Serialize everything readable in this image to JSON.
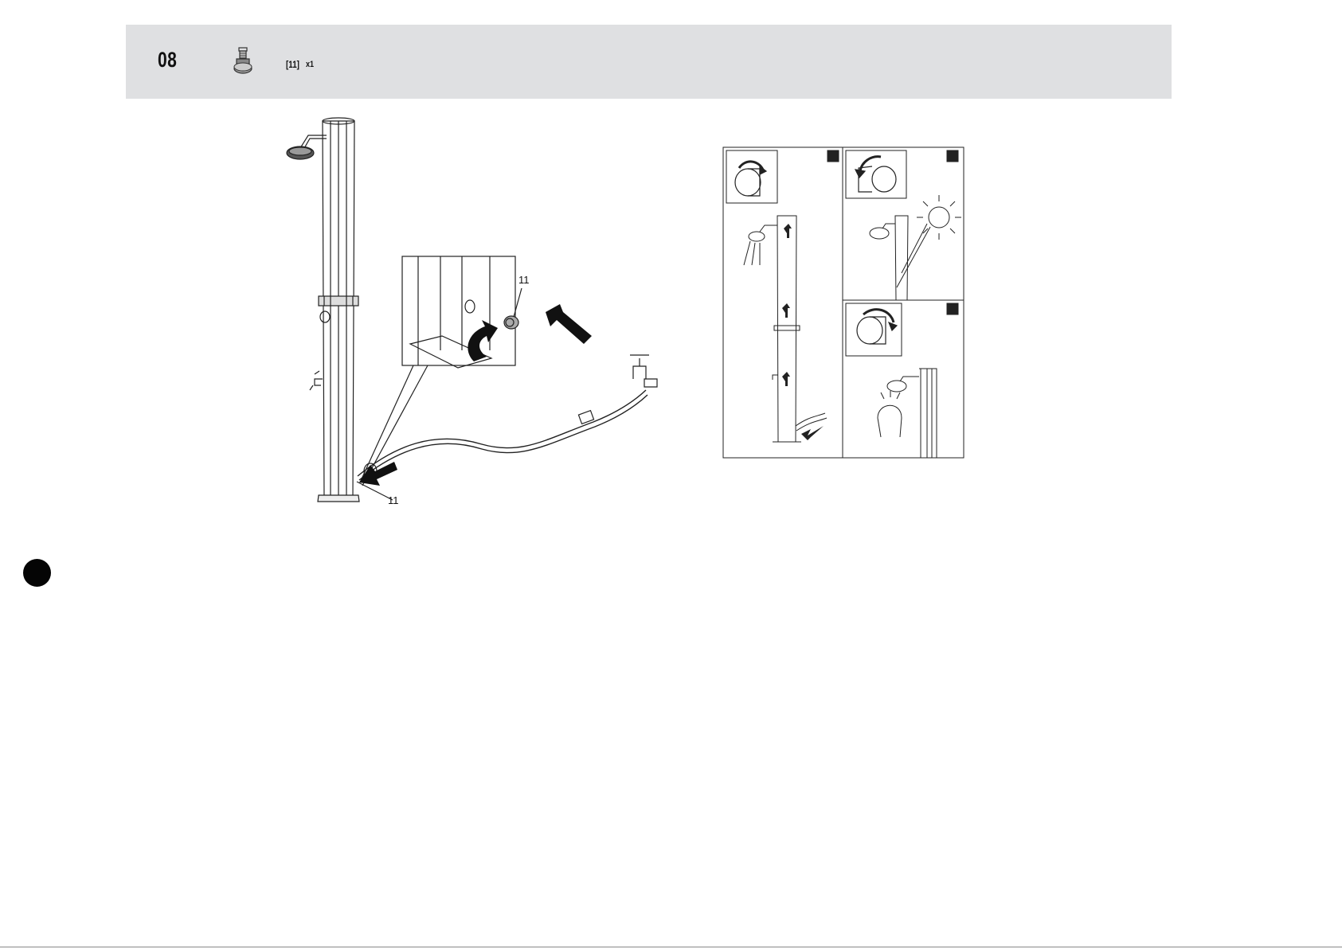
{
  "header": {
    "step_number": "08",
    "part_icon": "hose-connector-icon",
    "part_label": "[11]",
    "part_quantity": "x1"
  },
  "main_figure": {
    "callout_detail": "11",
    "callout_base": "11"
  },
  "usage_figure": {
    "icons": [
      "tap-open-icon",
      "tap-close-icon",
      "tap-open-icon",
      "sun-icon",
      "shower-head-icon"
    ]
  },
  "colors": {
    "header_band": "#dfe0e2",
    "ink": "#111111"
  }
}
